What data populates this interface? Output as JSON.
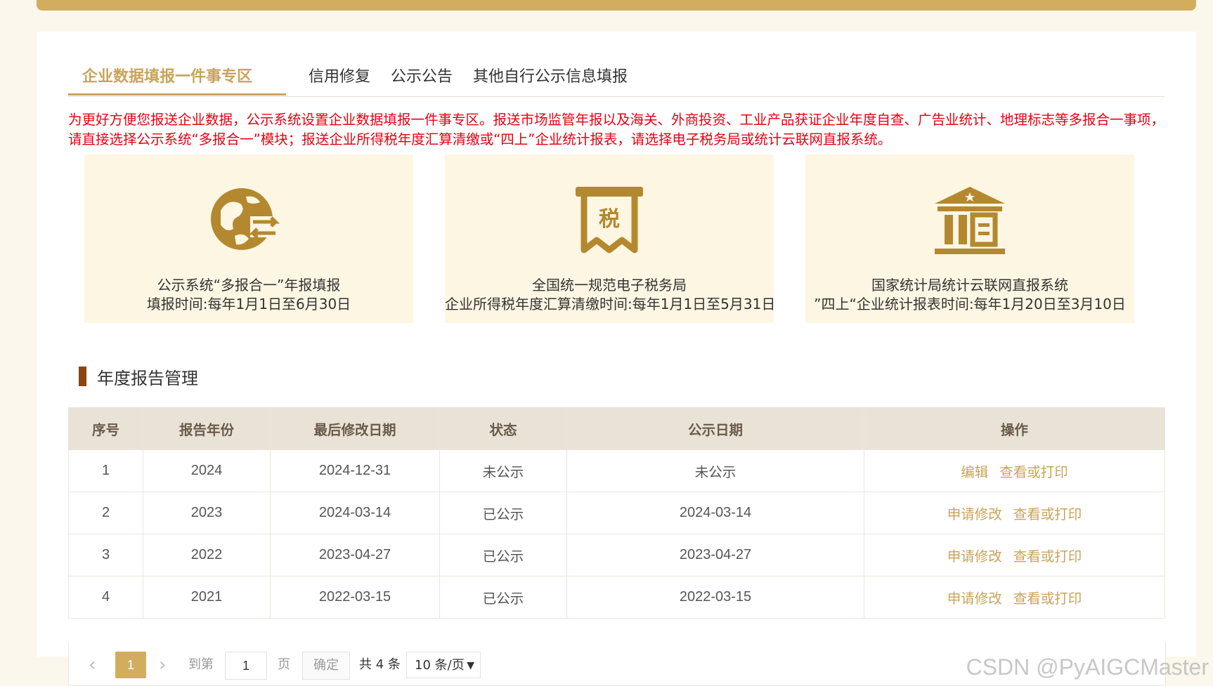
{
  "tabs": [
    {
      "label": "企业数据填报一件事专区",
      "active": true
    },
    {
      "label": "信用修复",
      "active": false
    },
    {
      "label": "公示公告",
      "active": false
    },
    {
      "label": "其他自行公示信息填报",
      "active": false
    }
  ],
  "notice": "为更好方便您报送企业数据，公示系统设置企业数据填报一件事专区。报送市场监管年报以及海关、外商投资、工业产品获证企业年度自查、广告业统计、地理标志等多报合一事项，请直接选择公示系统“多报合一”模块；报送企业所得税年度汇算清缴或“四上”企业统计报表，请选择电子税务局或统计云联网直报系统。",
  "cards": [
    {
      "icon": "globe-exchange-icon",
      "line1": "公示系统“多报合一”年报填报",
      "line2": "填报时间:每年1月1日至6月30日"
    },
    {
      "icon": "tax-receipt-icon",
      "icon_text": "税",
      "line1": "全国统一规范电子税务局",
      "line2": "企业所得税年度汇算清缴时间:每年1月1日至5月31日"
    },
    {
      "icon": "government-building-icon",
      "line1": "国家统计局统计云联网直报系统",
      "line2": "”四上“企业统计报表时间:每年1月20日至3月10日"
    }
  ],
  "section_title": "年度报告管理",
  "table": {
    "headers": [
      "序号",
      "报告年份",
      "最后修改日期",
      "状态",
      "公示日期",
      "操作"
    ],
    "rows": [
      {
        "index": "1",
        "year": "2024",
        "modified": "2024-12-31",
        "status": "未公示",
        "publish_date": "未公示",
        "action1": "编辑",
        "action2": "查看或打印"
      },
      {
        "index": "2",
        "year": "2023",
        "modified": "2024-03-14",
        "status": "已公示",
        "publish_date": "2024-03-14",
        "action1": "申请修改",
        "action2": "查看或打印"
      },
      {
        "index": "3",
        "year": "2022",
        "modified": "2023-04-27",
        "status": "已公示",
        "publish_date": "2023-04-27",
        "action1": "申请修改",
        "action2": "查看或打印"
      },
      {
        "index": "4",
        "year": "2021",
        "modified": "2022-03-15",
        "status": "已公示",
        "publish_date": "2022-03-15",
        "action1": "申请修改",
        "action2": "查看或打印"
      }
    ]
  },
  "pagination": {
    "prev": "‹",
    "current_page": "1",
    "next": "›",
    "goto_label": "到第",
    "page_input_value": "1",
    "page_label": "页",
    "confirm_label": "确定",
    "total": "共 4 条",
    "page_size": "10 条/页"
  },
  "watermark": "CSDN @PyAIGCMaster",
  "colors": {
    "accent": "#c8a45a",
    "icon": "#b4882e",
    "card_bg": "#fdf6e3",
    "notice": "#e60012",
    "section_bar": "#8b4513",
    "header_bg": "#e8e2d7"
  }
}
